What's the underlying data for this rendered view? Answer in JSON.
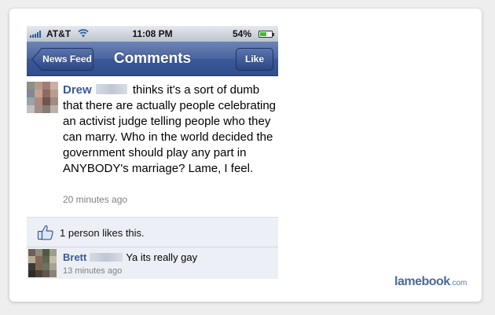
{
  "status_bar": {
    "carrier": "AT&T",
    "time": "11:08 PM",
    "battery_text": "54%",
    "battery_level": 0.54
  },
  "nav": {
    "back_label": "News Feed",
    "title": "Comments",
    "like_label": "Like"
  },
  "post": {
    "author": "Drew",
    "text": "thinks it's a sort of dumb that there are actually people celebrating an activist judge telling people who they can marry. Who in the world decided the government should play any part in ANYBODY's marriage?  Lame, I feel.",
    "time": "20 minutes ago"
  },
  "likes": {
    "text": "1 person likes this."
  },
  "comments": [
    {
      "author": "Brett",
      "text": "Ya its really gay",
      "time": "13 minutes ago"
    }
  ],
  "watermark": {
    "brand": "lamebook",
    "tld": ".com"
  },
  "colors": {
    "facebook_blue": "#3b5998",
    "likes_background": "#eceff5",
    "battery_green": "#3cbf2c"
  }
}
